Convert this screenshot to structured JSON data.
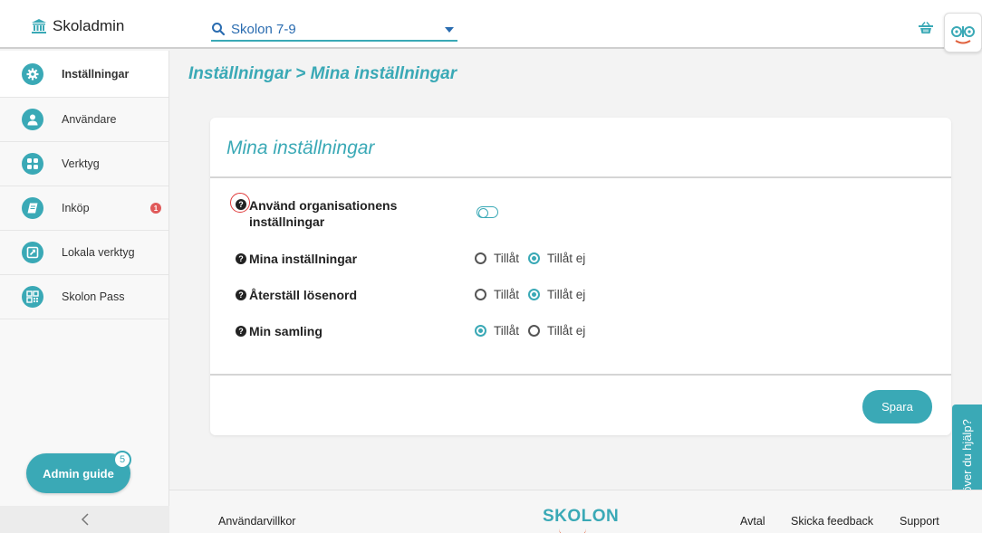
{
  "header": {
    "brand": "Skoladmin",
    "org_select": "Skolon 7-9"
  },
  "sidebar": {
    "items": [
      {
        "label": "Inställningar",
        "icon": "gear-icon",
        "active": true
      },
      {
        "label": "Användare",
        "icon": "user-icon"
      },
      {
        "label": "Verktyg",
        "icon": "grid-icon"
      },
      {
        "label": "Inköp",
        "icon": "book-icon",
        "badge": "1"
      },
      {
        "label": "Lokala verktyg",
        "icon": "external-link-icon"
      },
      {
        "label": "Skolon Pass",
        "icon": "qr-code-icon"
      }
    ],
    "admin_guide": "Admin guide",
    "admin_guide_count": "5"
  },
  "main": {
    "breadcrumb": "Inställningar > Mina inställningar",
    "card_title": "Mina inställningar",
    "settings": [
      {
        "label": "Använd organisationens inställningar",
        "control": "toggle",
        "on": false
      },
      {
        "label": "Mina inställningar",
        "allow": "Tillåt",
        "deny": "Tillåt ej",
        "selected": "deny"
      },
      {
        "label": "Återställ lösenord",
        "allow": "Tillåt",
        "deny": "Tillåt ej",
        "selected": "deny"
      },
      {
        "label": "Min samling",
        "allow": "Tillåt",
        "deny": "Tillåt ej",
        "selected": "allow"
      }
    ],
    "save_label": "Spara"
  },
  "help_tab": "Behöver du hjälp?",
  "footer": {
    "terms": "Användarvillkor",
    "logo": "SKOLON",
    "agreement": "Avtal",
    "feedback": "Skicka feedback",
    "support": "Support"
  },
  "colors": {
    "accent": "#3aa9b6",
    "badge": "#e05a5a",
    "focus_ring": "#e03a3a"
  }
}
